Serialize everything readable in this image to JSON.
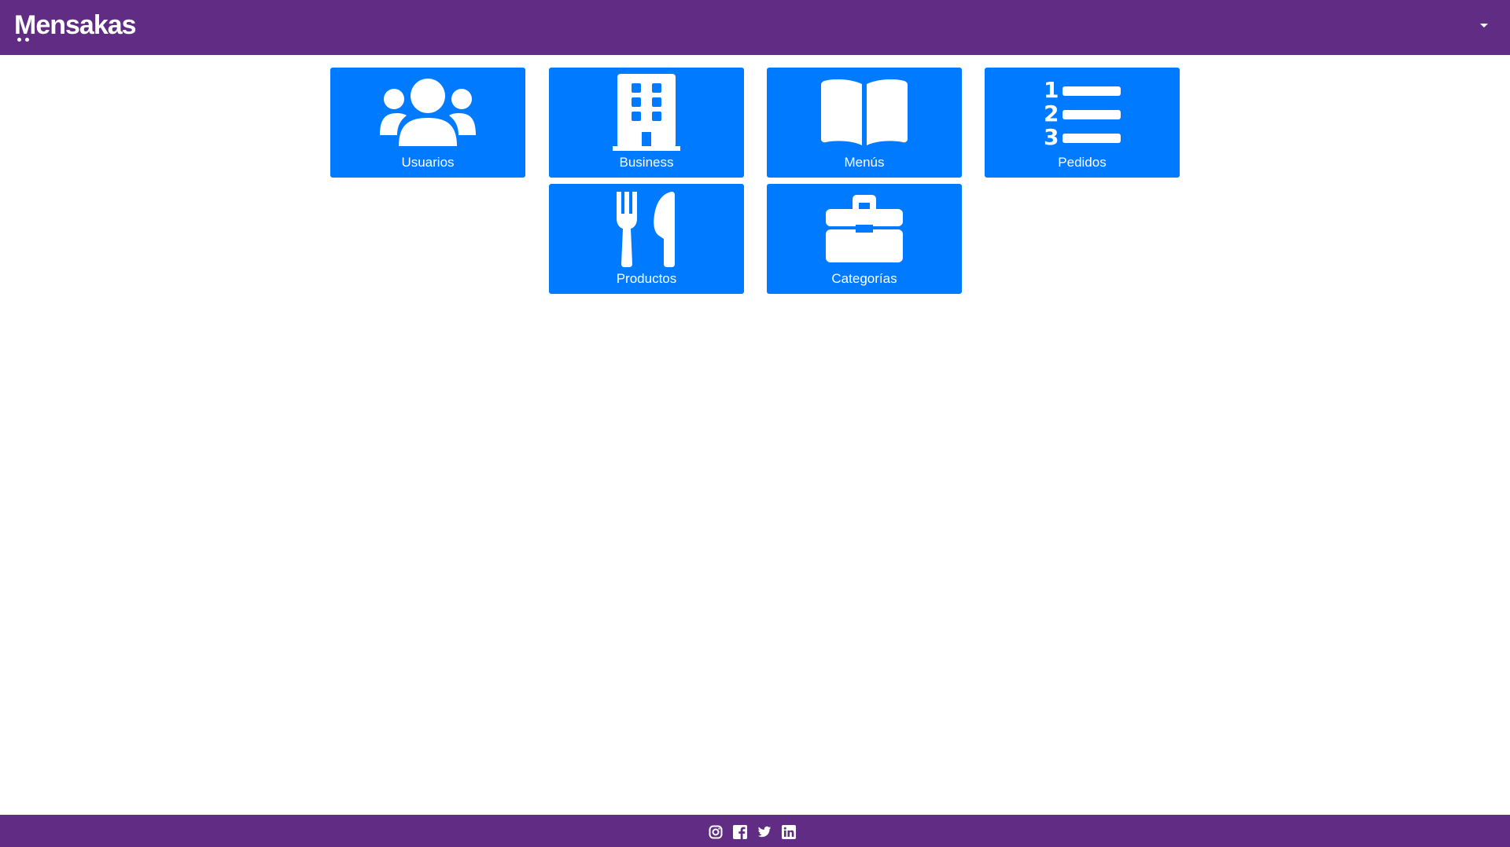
{
  "header": {
    "brand": "Mensakas",
    "user_menu_icon": "caret-down-icon"
  },
  "colors": {
    "header_bg": "#612c84",
    "tile_bg": "#007bff",
    "tile_text": "#ffffff"
  },
  "tiles": [
    {
      "label": "Usuarios",
      "icon": "users-icon"
    },
    {
      "label": "Business",
      "icon": "building-icon"
    },
    {
      "label": "Menús",
      "icon": "book-open-icon"
    },
    {
      "label": "Pedidos",
      "icon": "list-ol-icon"
    },
    {
      "label": "Productos",
      "icon": "utensils-icon"
    },
    {
      "label": "Categorías",
      "icon": "toolbox-icon"
    }
  ],
  "footer": {
    "social": [
      "instagram-icon",
      "facebook-icon",
      "twitter-icon",
      "linkedin-icon"
    ]
  }
}
